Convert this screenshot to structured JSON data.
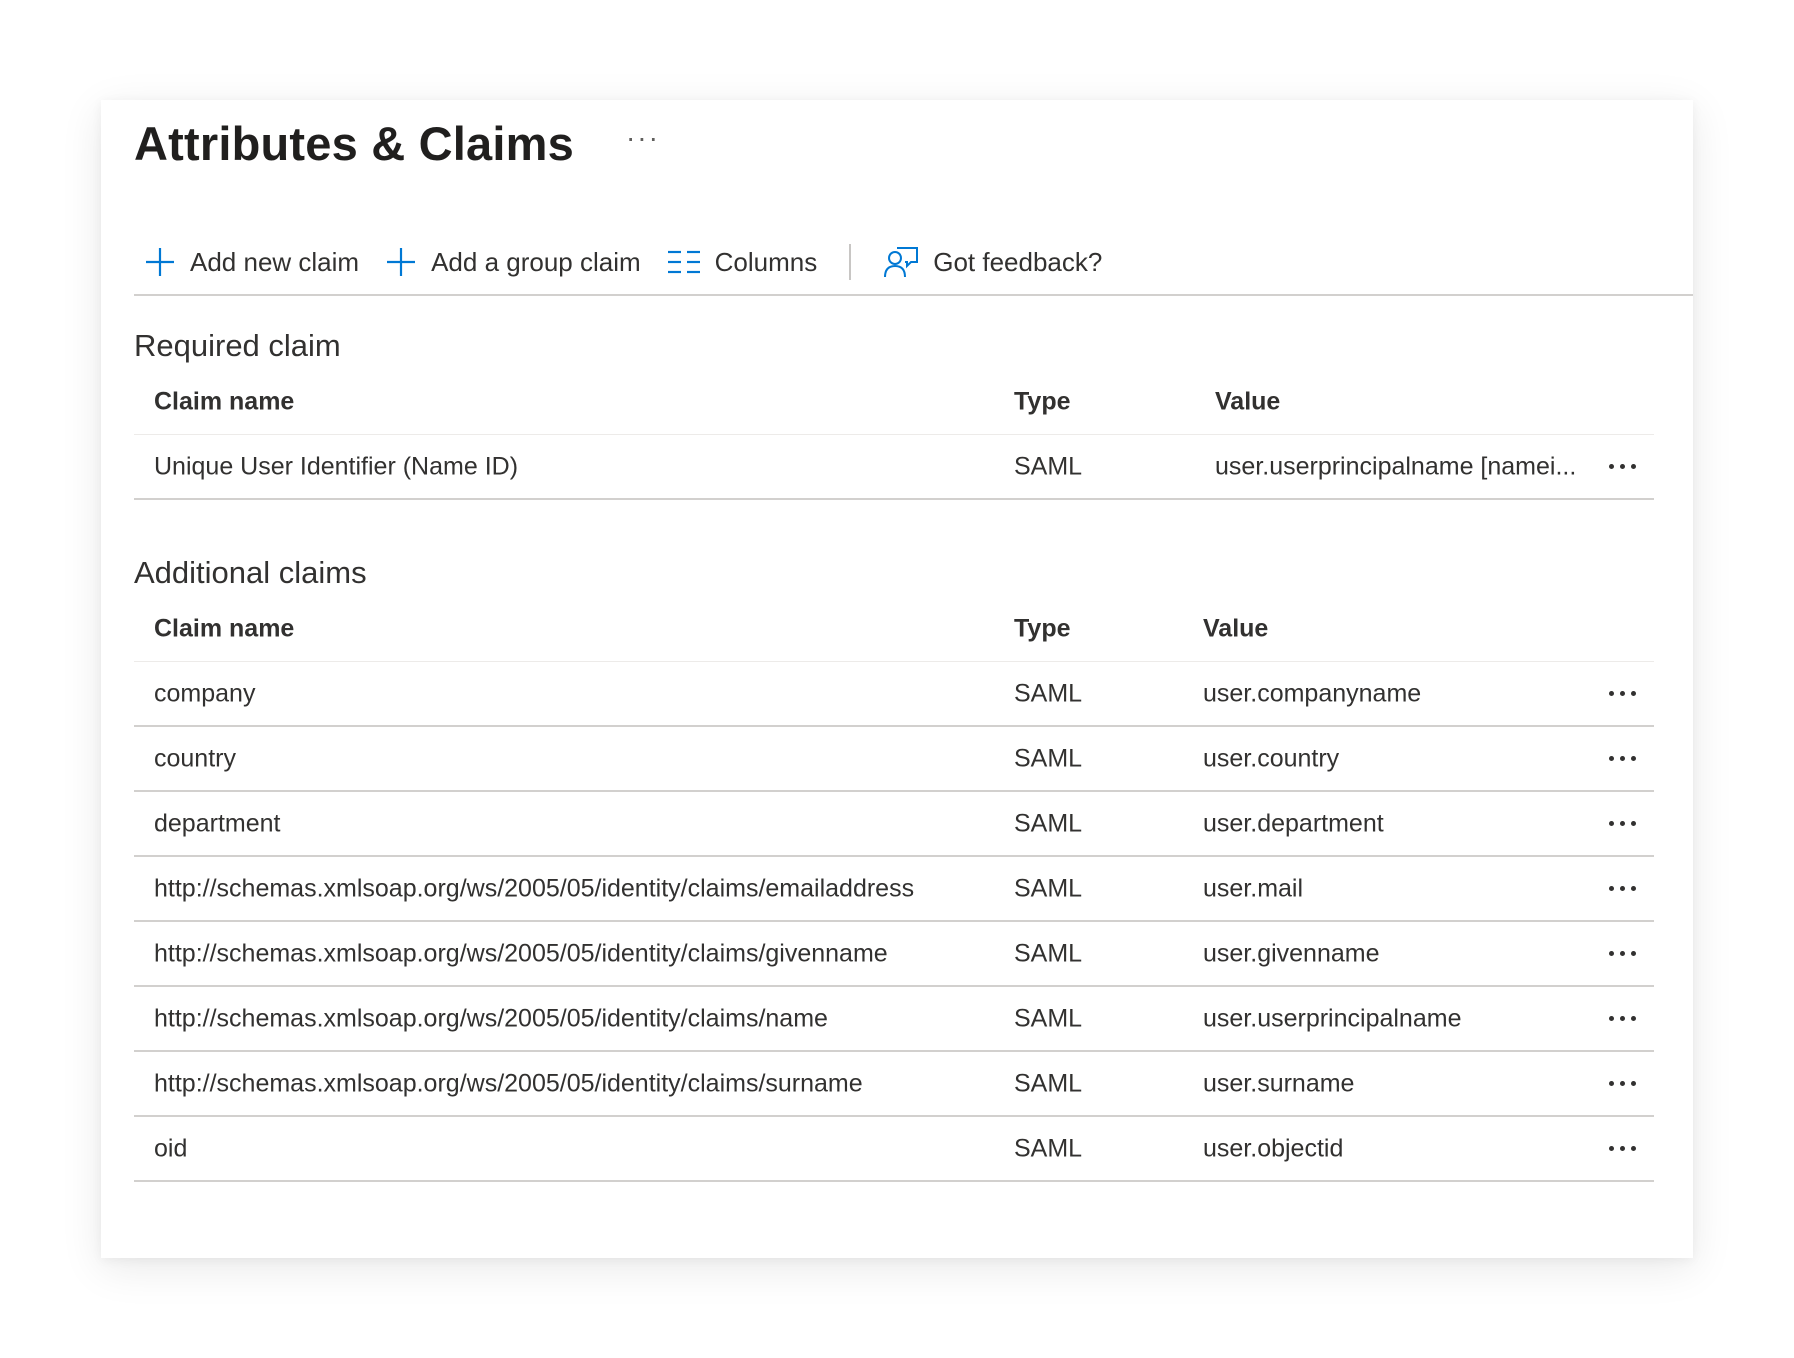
{
  "page": {
    "title": "Attributes & Claims",
    "more_label": "···"
  },
  "toolbar": {
    "add_claim": "Add new claim",
    "add_group_claim": "Add a group claim",
    "columns": "Columns",
    "feedback": "Got feedback?"
  },
  "colors": {
    "accent": "#0078d4",
    "text": "#323130",
    "divider": "#d2d0ce"
  },
  "required": {
    "title": "Required claim",
    "headers": {
      "name": "Claim name",
      "type": "Type",
      "value": "Value"
    },
    "rows": [
      {
        "name": "Unique User Identifier (Name ID)",
        "type": "SAML",
        "value": "user.userprincipalname [namei..."
      }
    ]
  },
  "additional": {
    "title": "Additional claims",
    "headers": {
      "name": "Claim name",
      "type": "Type",
      "value": "Value"
    },
    "rows": [
      {
        "name": "company",
        "type": "SAML",
        "value": "user.companyname"
      },
      {
        "name": "country",
        "type": "SAML",
        "value": "user.country"
      },
      {
        "name": "department",
        "type": "SAML",
        "value": "user.department"
      },
      {
        "name": "http://schemas.xmlsoap.org/ws/2005/05/identity/claims/emailaddress",
        "type": "SAML",
        "value": "user.mail"
      },
      {
        "name": "http://schemas.xmlsoap.org/ws/2005/05/identity/claims/givenname",
        "type": "SAML",
        "value": "user.givenname"
      },
      {
        "name": "http://schemas.xmlsoap.org/ws/2005/05/identity/claims/name",
        "type": "SAML",
        "value": "user.userprincipalname"
      },
      {
        "name": "http://schemas.xmlsoap.org/ws/2005/05/identity/claims/surname",
        "type": "SAML",
        "value": "user.surname"
      },
      {
        "name": "oid",
        "type": "SAML",
        "value": "user.objectid"
      }
    ]
  }
}
